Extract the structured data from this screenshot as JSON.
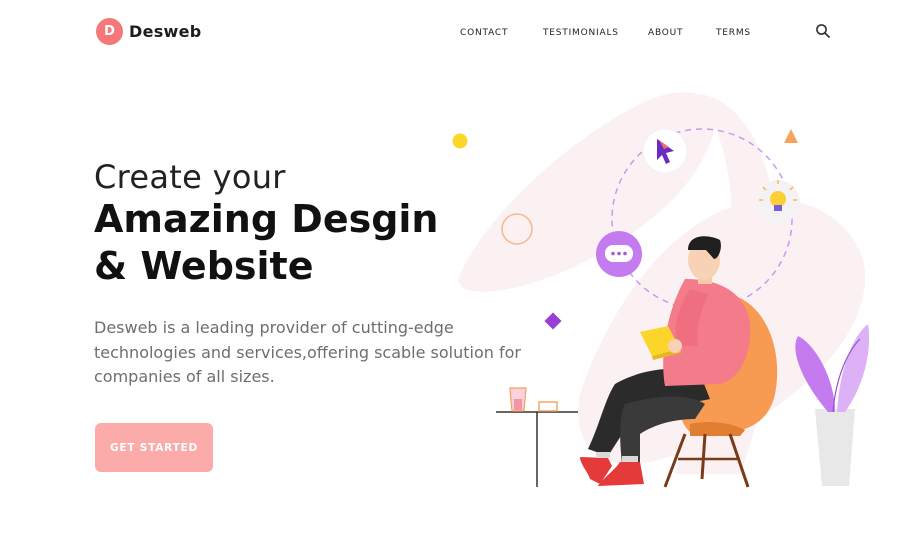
{
  "brand": {
    "initial": "D",
    "name": "Desweb"
  },
  "nav": {
    "items": [
      {
        "label": "CONTACT"
      },
      {
        "label": "TESTIMONIALS"
      },
      {
        "label": "ABOUT"
      },
      {
        "label": "TERMS"
      }
    ],
    "search_icon": "search-icon"
  },
  "hero": {
    "subtitle": "Create your",
    "title_line1": "Amazing Desgin",
    "title_line2": "& Website",
    "description": "Desweb is a leading provider of cutting-edge technologies and services,offering scable solution for companies of all sizes.",
    "cta_label": "GET STARTED"
  },
  "illustration": {
    "chat_bubble_text": "..."
  },
  "colors": {
    "accent": "#f4777a",
    "cta": "#fbabaa",
    "text_dark": "#111111",
    "text_muted": "#6e6e6e",
    "blob": "#fbf1f2",
    "chair": "#f79a52",
    "shirt": "#f47b8a",
    "purple": "#b56ae6"
  }
}
